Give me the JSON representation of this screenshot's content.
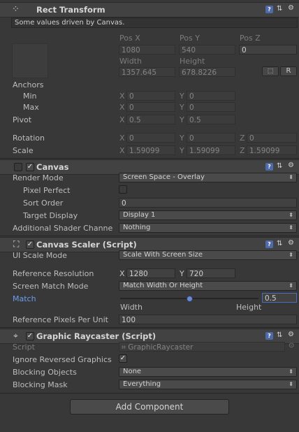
{
  "rect_transform": {
    "title": "Rect Transform",
    "notice": "Some values driven by Canvas.",
    "pos_x_label": "Pos X",
    "pos_y_label": "Pos Y",
    "pos_z_label": "Pos Z",
    "pos_x": "1080",
    "pos_y": "540",
    "pos_z": "0",
    "width_label": "Width",
    "height_label": "Height",
    "width": "1357.645",
    "height": "678.8226",
    "r_button": "R",
    "anchors_label": "Anchors",
    "min_label": "Min",
    "max_label": "Max",
    "anchor_min_x": "0",
    "anchor_min_y": "0",
    "anchor_max_x": "0",
    "anchor_max_y": "0",
    "pivot_label": "Pivot",
    "pivot_x": "0.5",
    "pivot_y": "0.5",
    "rotation_label": "Rotation",
    "rotation_x": "0",
    "rotation_y": "0",
    "rotation_z": "0",
    "scale_label": "Scale",
    "scale_x": "1.59099",
    "scale_y": "1.59099",
    "scale_z": "1.59099",
    "axis_x": "X",
    "axis_y": "Y",
    "axis_z": "Z"
  },
  "canvas": {
    "title": "Canvas",
    "render_mode_label": "Render Mode",
    "render_mode": "Screen Space - Overlay",
    "pixel_perfect_label": "Pixel Perfect",
    "sort_order_label": "Sort Order",
    "sort_order": "0",
    "target_display_label": "Target Display",
    "target_display": "Display 1",
    "additional_shader_label": "Additional Shader Channe",
    "additional_shader": "Nothing"
  },
  "canvas_scaler": {
    "title": "Canvas Scaler (Script)",
    "ui_scale_mode_label": "UI Scale Mode",
    "ui_scale_mode": "Scale With Screen Size",
    "ref_res_label": "Reference Resolution",
    "ref_x": "1280",
    "ref_y": "720",
    "screen_match_label": "Screen Match Mode",
    "screen_match": "Match Width Or Height",
    "match_label": "Match",
    "match_value": "0.5",
    "match_fraction": 0.5,
    "width_label": "Width",
    "height_label": "Height",
    "ref_ppu_label": "Reference Pixels Per Unit",
    "ref_ppu": "100"
  },
  "graphic_raycaster": {
    "title": "Graphic Raycaster (Script)",
    "script_label": "Script",
    "script_value": "GraphicRaycaster",
    "ignore_reversed_label": "Ignore Reversed Graphics",
    "blocking_objects_label": "Blocking Objects",
    "blocking_objects": "None",
    "blocking_mask_label": "Blocking Mask",
    "blocking_mask": "Everything"
  },
  "add_component": "Add Component",
  "colors": {
    "accent_blue": "#6b9ef0",
    "background": "#383838"
  }
}
